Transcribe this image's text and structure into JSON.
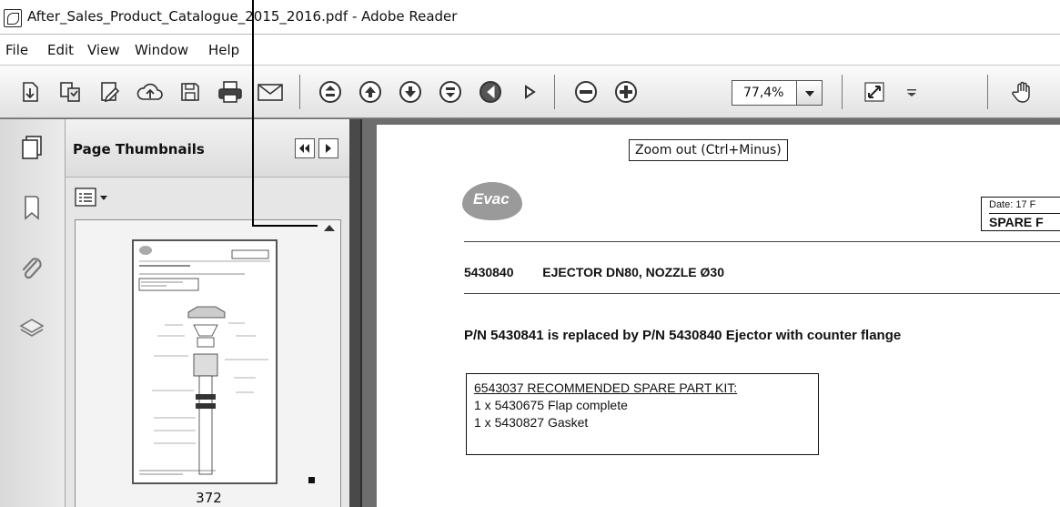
{
  "window": {
    "title": "After_Sales_Product_Catalogue_2015_2016.pdf - Adobe Reader"
  },
  "menu": [
    "File",
    "Edit",
    "View",
    "Window",
    "Help"
  ],
  "toolbar": {
    "zoom_value": "77,4%",
    "icons": [
      "create-pdf-icon",
      "convert-icon",
      "sign-icon",
      "upload-cloud-icon",
      "save-icon",
      "print-icon",
      "email-icon",
      "first-page-icon",
      "previous-page-icon",
      "next-page-icon",
      "last-page-icon",
      "go-back-icon",
      "go-forward-icon",
      "zoom-out-icon",
      "zoom-in-icon",
      "zoom-dropdown-arrow",
      "fit-page-icon",
      "toolbar-overflow-icon",
      "hand-tool-icon"
    ]
  },
  "sidebar": {
    "panel_title": "Page Thumbnails",
    "rail_icons": [
      "page-thumbnails-icon",
      "bookmarks-icon",
      "attachments-icon",
      "layers-icon"
    ],
    "thumbnail_label": "372"
  },
  "tooltip": "Zoom out (Ctrl+Minus)",
  "document": {
    "logo_text": "Evac",
    "date_text": "Date:  17 F",
    "header_text": "SPARE F",
    "part_number": "5430840",
    "part_description": "EJECTOR DN80, NOZZLE Ø30",
    "replacement_note": "P/N 5430841 is replaced by P/N 5430840 Ejector with counter flange",
    "kit": {
      "title": "6543037 RECOMMENDED SPARE PART KIT:",
      "items": [
        "1 x 5430675 Flap complete",
        "1 x 5430827 Gasket"
      ]
    }
  }
}
